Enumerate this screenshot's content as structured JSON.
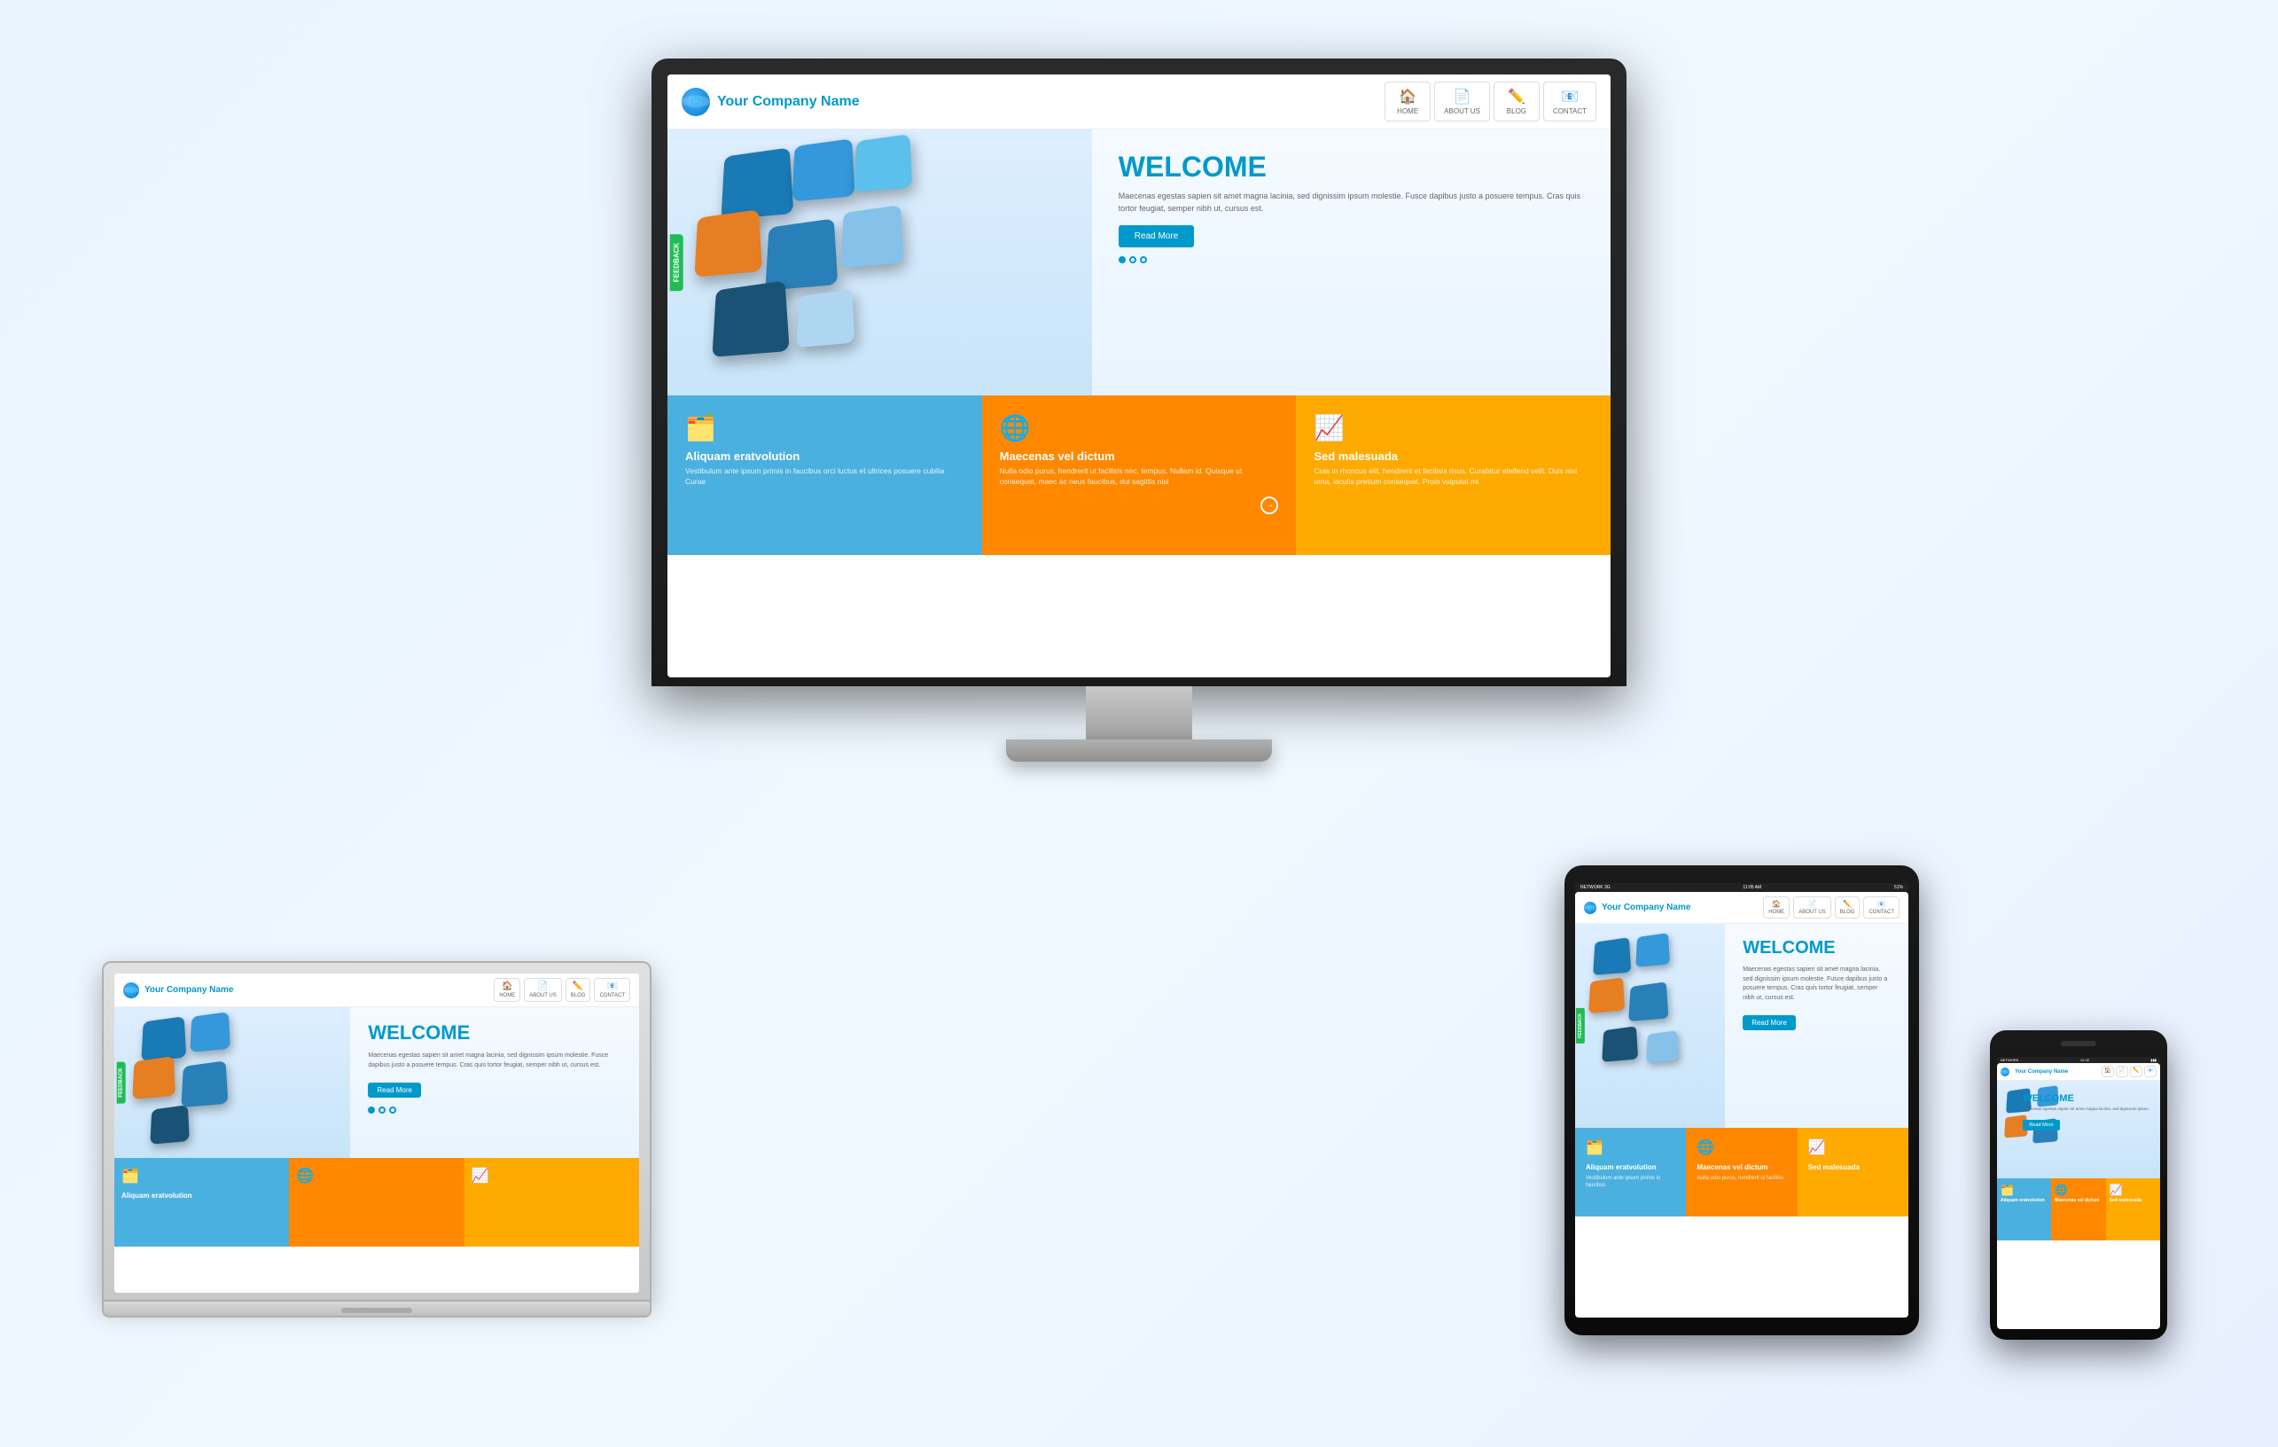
{
  "page": {
    "background": "#f0f5ff"
  },
  "website": {
    "company_name": "Your Company Name",
    "nav": {
      "home": "HOME",
      "about": "ABOUT US",
      "blog": "BLOG",
      "contact": "CONTACT"
    },
    "hero": {
      "title": "WELCOME",
      "text": "Maecenas egestas sapien sit amet magna lacinia, sed dignissim ipsum molestie. Fusce dapibus justo a posuere tempus. Cras quis tortor feugiat, semper nibh ut, cursus est.",
      "read_more": "Read More",
      "feedback": "FEEDBACK"
    },
    "features": [
      {
        "title": "Aliquam eratvolution",
        "text": "Vestibulum ante ipsum primis in faucibus orci luctus et ultrices posuere cubilia Curae",
        "color": "blue"
      },
      {
        "title": "Maecenas vel dictum",
        "text": "Nulla odio purus, hendrerit ut facilisis nec, tempus. Nullam id. Quisque ut consequat, maec ac neus faucibus, dui sagittis nisl",
        "color": "orange"
      },
      {
        "title": "Sed malesuada",
        "text": "Cras in rhoncus elit, hendrerit et facilisis risus. Curabitur eleifend velit. Duis nisl urna, iaculis pretium consequat. Proin vulputat mi",
        "color": "gold"
      }
    ]
  },
  "phone": {
    "network": "NETWORK",
    "time": "12:32",
    "battery": "▮▮▮"
  },
  "tablet": {
    "network": "NETWORK 3G",
    "time": "11:05 AM",
    "battery": "51%"
  }
}
